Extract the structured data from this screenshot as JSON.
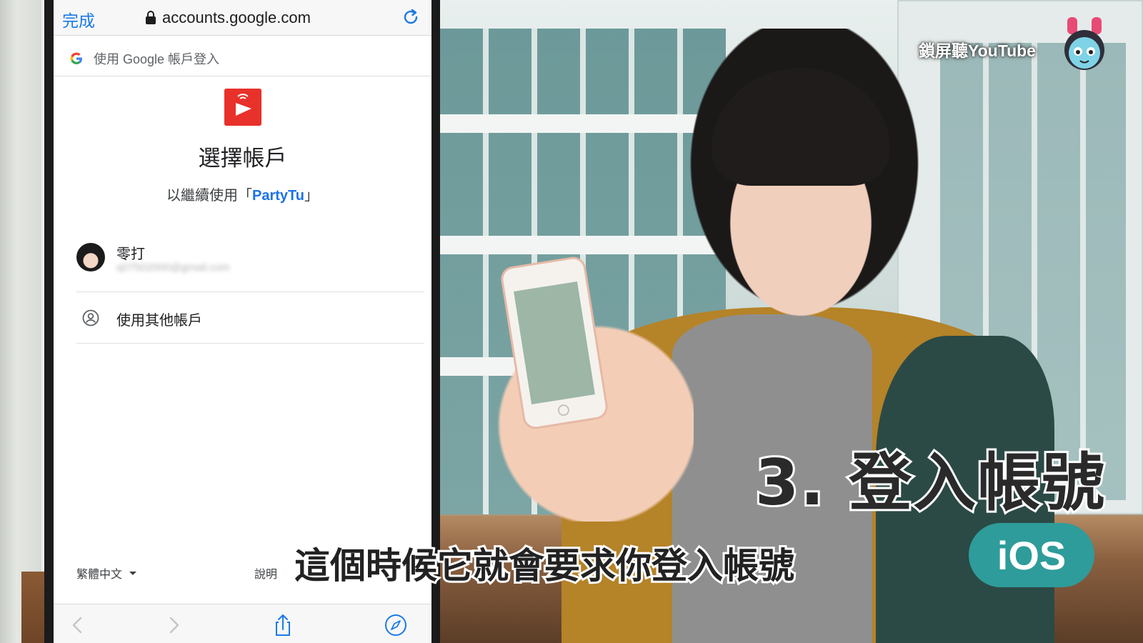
{
  "safari": {
    "done_label": "完成",
    "url": "accounts.google.com"
  },
  "google_signin": {
    "header_text": "使用 Google 帳戶登入",
    "title": "選擇帳戶",
    "continue_prefix": "以繼續使用「",
    "app_name": "PartyTu",
    "continue_suffix": "」",
    "account": {
      "name": "零打",
      "email": "q07502000@gmail.com"
    },
    "other_account_label": "使用其他帳戶",
    "language": "繁體中文",
    "help_label": "說明"
  },
  "video": {
    "channel_tag": "鎖屏聽YouTube",
    "step_title": "3. 登入帳號",
    "subtitle": "這個時候它就會要求你登入帳號",
    "platform_badge": "iOS"
  },
  "colors": {
    "link_blue": "#1a73e8",
    "ios_badge": "#2e9c9a",
    "app_logo_red": "#e8312a"
  },
  "icons": [
    "lock-icon",
    "reload-icon",
    "google-logo-icon",
    "person-circle-icon",
    "caret-down-icon",
    "back-icon",
    "forward-icon",
    "share-icon",
    "compass-icon",
    "mascot-icon"
  ]
}
